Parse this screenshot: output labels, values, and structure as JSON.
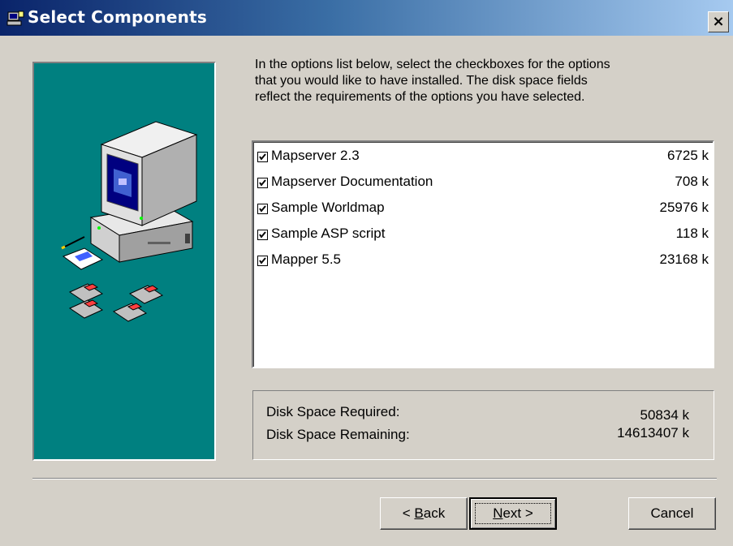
{
  "window": {
    "title": "Select Components",
    "title_icon": "setup-icon",
    "close_label": "×"
  },
  "instructions": "In the options list below, select the checkboxes for the options\nthat you would like to have installed.  The disk space fields\nreflect the requirements of the options you have selected.",
  "components": [
    {
      "label": "Mapserver 2.3",
      "size": "6725 k",
      "checked": true
    },
    {
      "label": "Mapserver Documentation",
      "size": "708 k",
      "checked": true
    },
    {
      "label": "Sample Worldmap",
      "size": "25976 k",
      "checked": true
    },
    {
      "label": "Sample ASP script",
      "size": "118 k",
      "checked": true
    },
    {
      "label": "Mapper 5.5",
      "size": "23168 k",
      "checked": true
    }
  ],
  "disk": {
    "required_label": "Disk Space Required:",
    "required_value": "50834 k",
    "remaining_label": "Disk Space Remaining:",
    "remaining_value": "14613407 k"
  },
  "buttons": {
    "back": {
      "prefix": "< ",
      "mnemonic": "B",
      "rest": "ack"
    },
    "next": {
      "mnemonic": "N",
      "rest": "ext >"
    },
    "cancel": "Cancel"
  },
  "colors": {
    "graphic_bg": "#008080",
    "title_start": "#0a246a",
    "title_end": "#a6caf0",
    "face": "#d4d0c8"
  }
}
